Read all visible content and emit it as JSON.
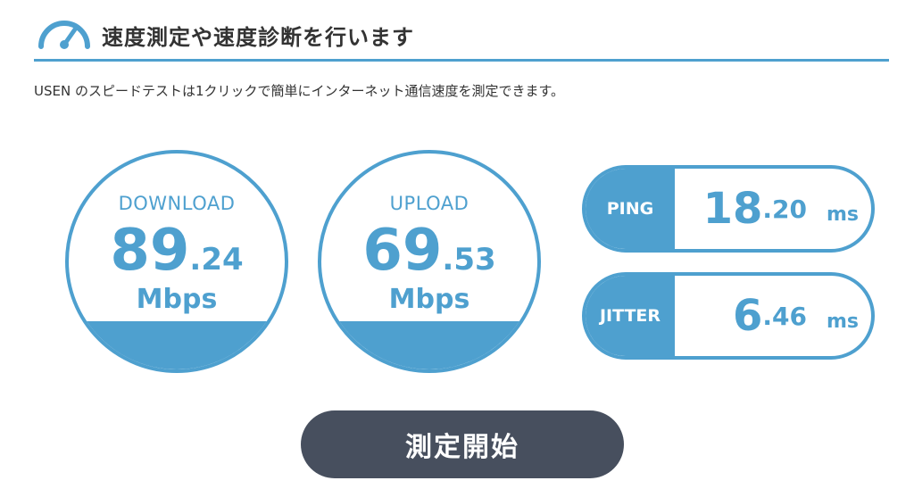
{
  "header": {
    "title": "速度測定や速度診断を行います",
    "icon": "speedometer-icon"
  },
  "description": "USEN のスピードテストは1クリックで簡単にインターネット通信速度を測定できます。",
  "download": {
    "label": "DOWNLOAD",
    "value_int": "89",
    "value_dec": ".24",
    "unit": "Mbps"
  },
  "upload": {
    "label": "UPLOAD",
    "value_int": "69",
    "value_dec": ".53",
    "unit": "Mbps"
  },
  "ping": {
    "label": "PING",
    "value_int": "18",
    "value_dec": ".20",
    "unit": "ms"
  },
  "jitter": {
    "label": "JITTER",
    "value_int": "6",
    "value_dec": ".46",
    "unit": "ms"
  },
  "start_button": {
    "label": "測定開始"
  },
  "colors": {
    "accent": "#4ea0cf",
    "button": "#474f5e",
    "text": "#333333"
  }
}
